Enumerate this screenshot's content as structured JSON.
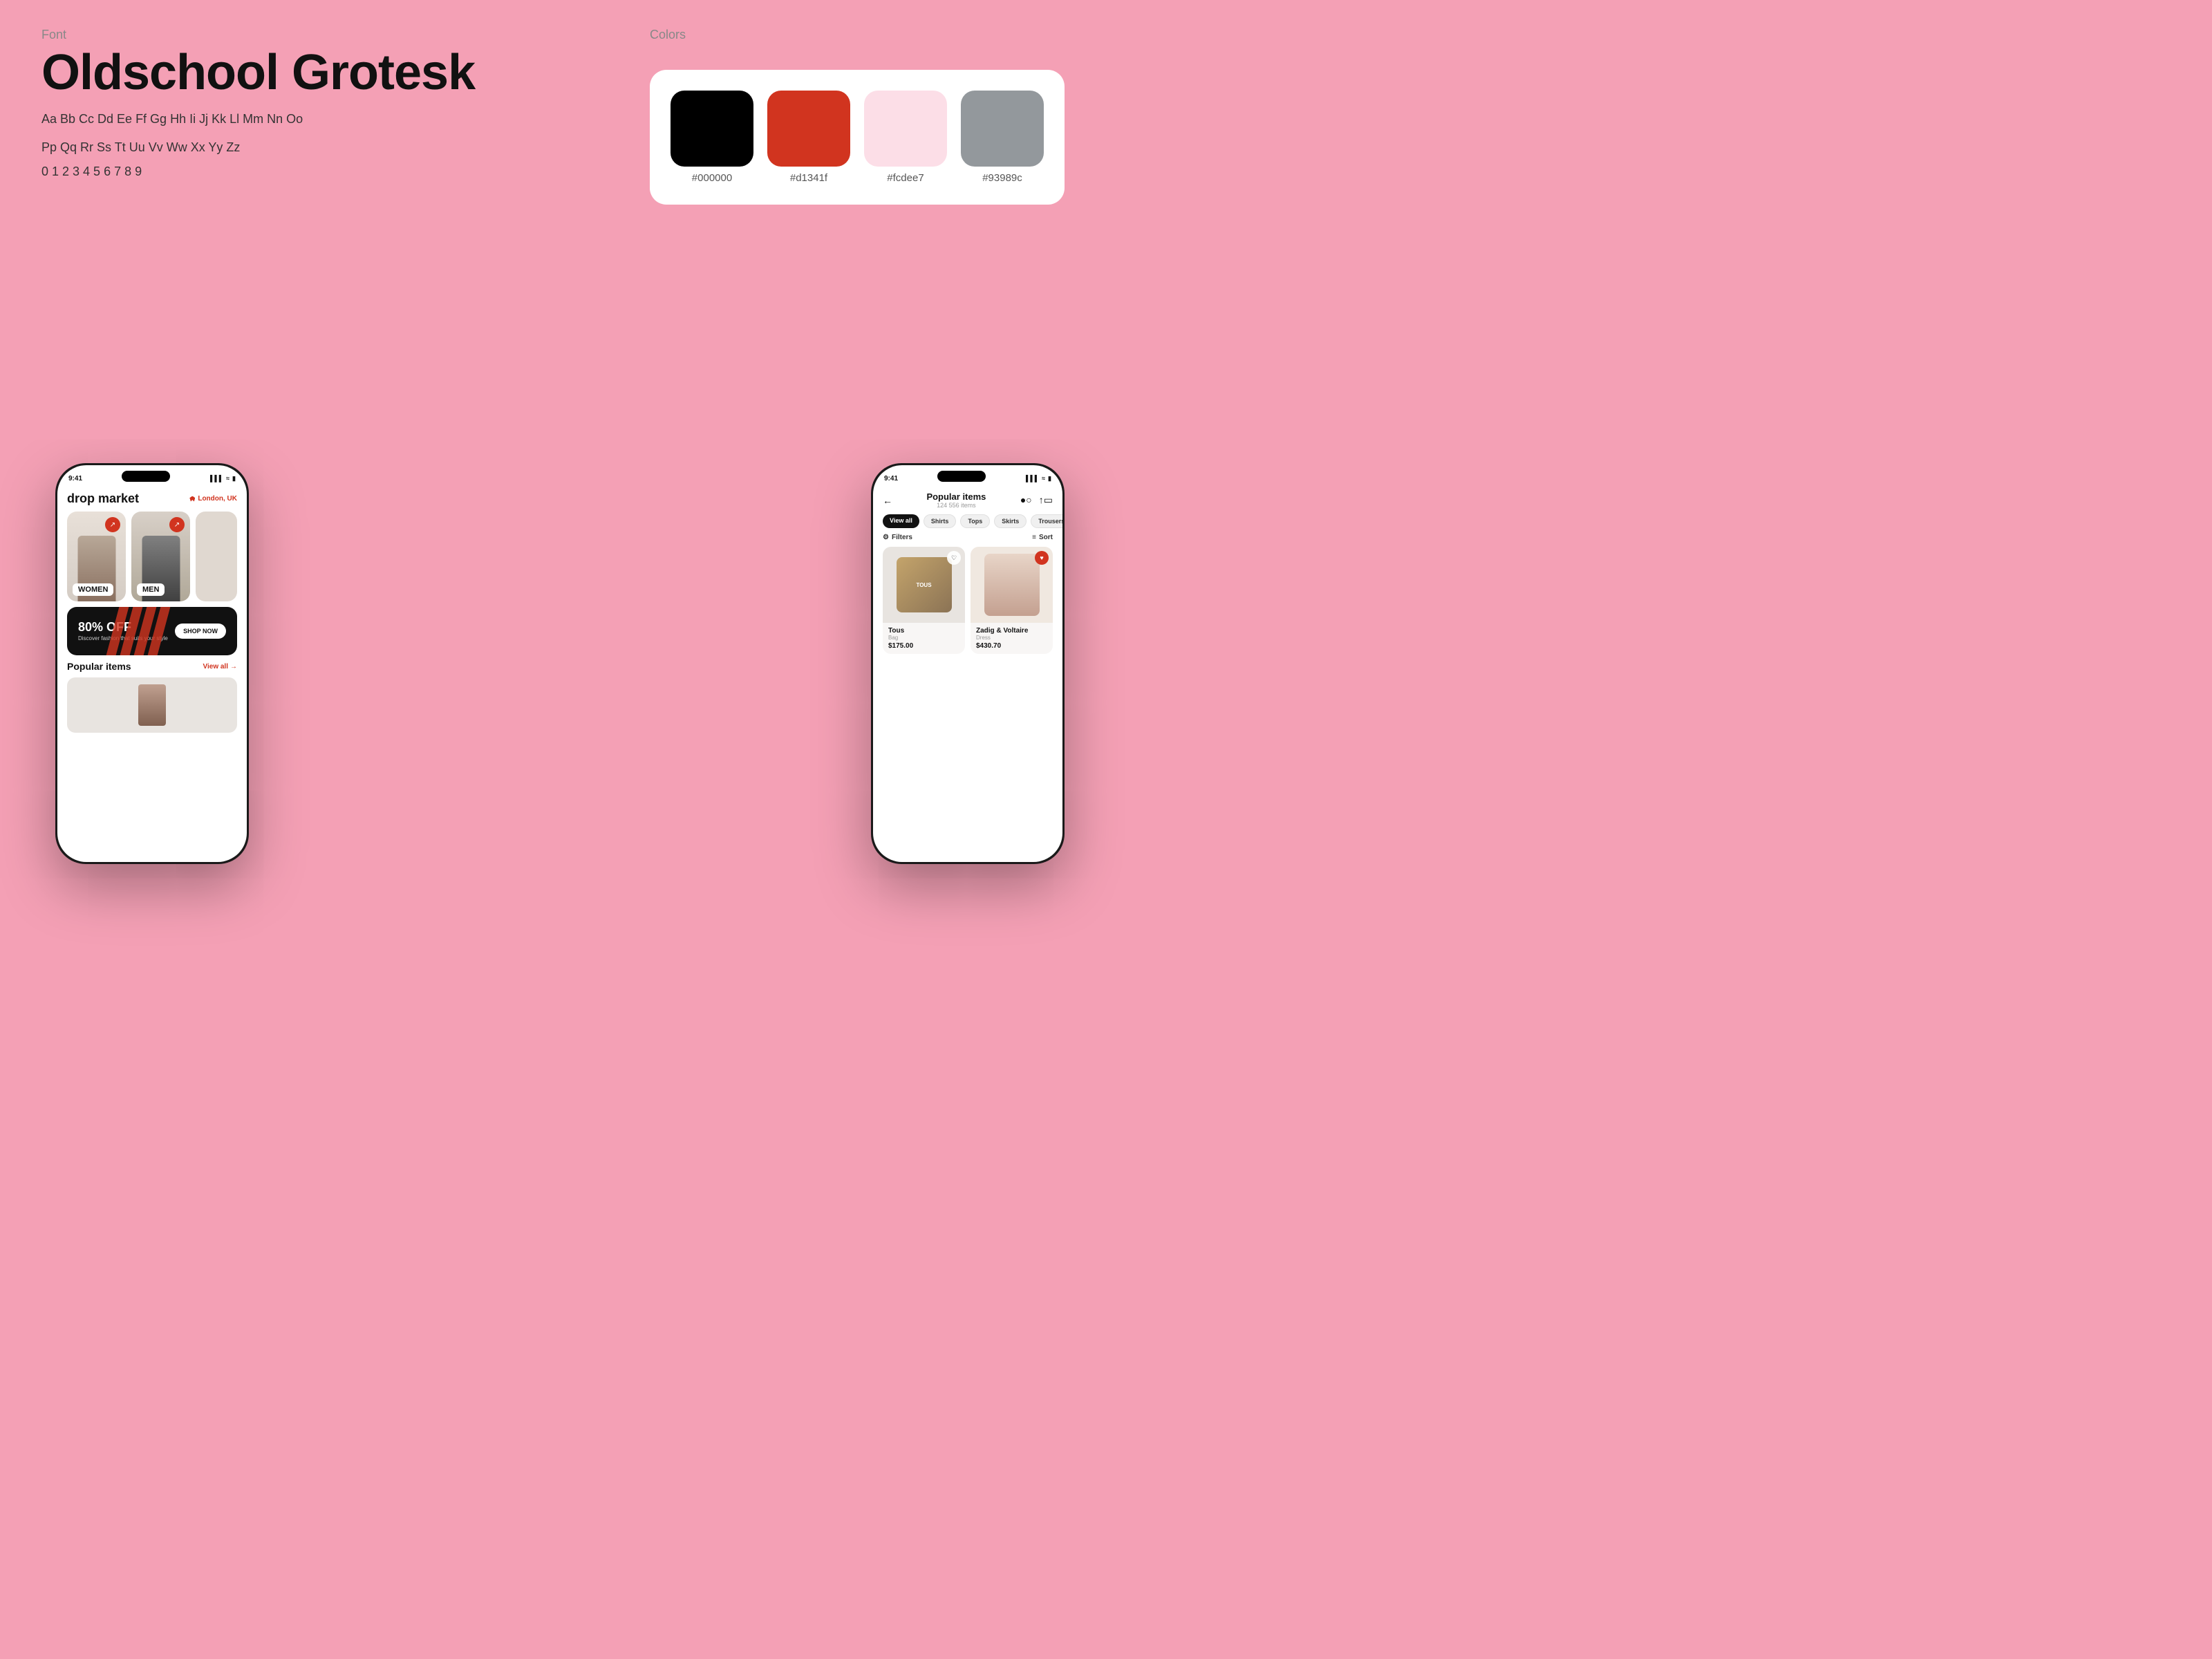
{
  "font": {
    "section_label": "Font",
    "font_name": "Oldschool Grotesk",
    "alphabet_line1": "Aa Bb Cc Dd Ee Ff Gg Hh Ii Jj Kk Ll Mm Nn Oo",
    "alphabet_line2": "Pp Qq Rr Ss Tt Uu Vv Ww Xx Yy Zz",
    "numbers": "0 1 2 3 4 5 6 7 8 9"
  },
  "colors": {
    "section_label": "Colors",
    "swatches": [
      {
        "hex": "#000000",
        "label": "#000000"
      },
      {
        "hex": "#d1341f",
        "label": "#d1341f"
      },
      {
        "hex": "#fcdee7",
        "label": "#fcdee7"
      },
      {
        "hex": "#93989c",
        "label": "#93989c"
      }
    ]
  },
  "phone1": {
    "time": "9:41",
    "app_title": "drop market",
    "location": "London, UK",
    "categories": [
      {
        "label": "WOMEN"
      },
      {
        "label": "MEN"
      }
    ],
    "promo": {
      "discount": "80% OFF",
      "sub_text": "Discover fashion that suits your style",
      "cta": "SHOP NOW"
    },
    "popular_label": "Popular items",
    "view_all": "View all"
  },
  "phone2": {
    "time": "9:41",
    "page_title": "Popular items",
    "items_count": "124 556 items",
    "tabs": [
      {
        "label": "View all",
        "active": true
      },
      {
        "label": "Shirts",
        "active": false
      },
      {
        "label": "Tops",
        "active": false
      },
      {
        "label": "Skirts",
        "active": false
      },
      {
        "label": "Trousers",
        "active": false
      }
    ],
    "filters_label": "Filters",
    "sort_label": "Sort",
    "products": [
      {
        "brand": "Tous",
        "type": "Bag",
        "price": "$175.00",
        "heart_filled": false
      },
      {
        "brand": "Zadig & Voltaire",
        "type": "Dress",
        "price": "$430.70",
        "heart_filled": true
      }
    ]
  }
}
